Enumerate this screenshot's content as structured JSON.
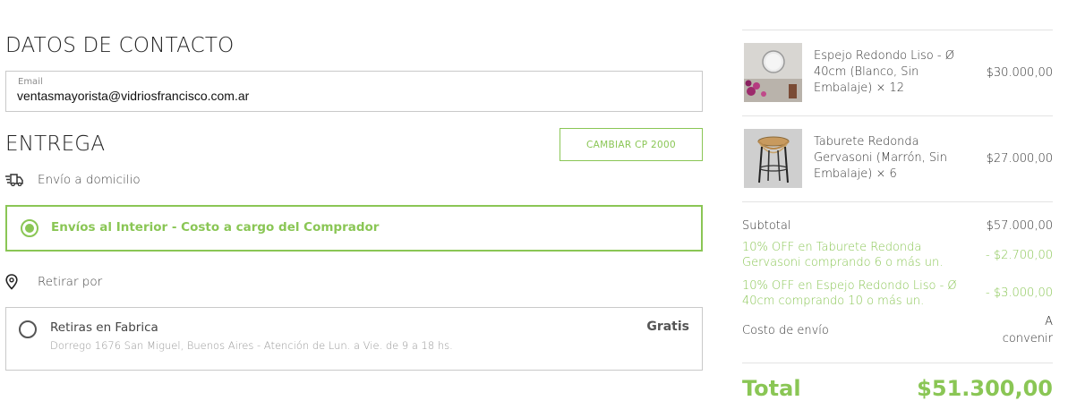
{
  "contact": {
    "title": "DATOS DE CONTACTO",
    "email_label": "Email",
    "email_value": "ventasmayorista@vidriosfrancisco.com.ar"
  },
  "delivery": {
    "title": "ENTREGA",
    "change_cp_label": "CAMBIAR CP 2000",
    "home_delivery_label": "Envío a domicilio",
    "home_options": [
      {
        "label": "Envíos al Interior - Costo a cargo del Comprador",
        "selected": true
      }
    ],
    "pickup_label": "Retirar por",
    "pickup_options": [
      {
        "label": "Retiras en Fabrica",
        "detail": "Dorrego 1676 San Miguel, Buenos Aires - Atención de Lun. a Vie. de 9 a 18 hs.",
        "price": "Gratis",
        "selected": false
      }
    ],
    "accent_color": "#8ac655"
  },
  "cart": {
    "items": [
      {
        "name": "Espejo Redondo Liso - Ø 40cm (Blanco, Sin Embalaje) × 12",
        "price": "$30.000,00",
        "thumb_icon": "mirror-thumbnail"
      },
      {
        "name": "Taburete Redonda Gervasoni (Marrón, Sin Embalaje) × 6",
        "price": "$27.000,00",
        "thumb_icon": "stool-thumbnail"
      }
    ],
    "subtotal_label": "Subtotal",
    "subtotal_value": "$57.000,00",
    "discounts": [
      {
        "label": "10% OFF en Taburete Redonda Gervasoni comprando 6 o más un.",
        "value": "- $2.700,00"
      },
      {
        "label": "10% OFF en Espejo Redondo Liso - Ø 40cm comprando 10 o más un.",
        "value": "- $3.000,00"
      }
    ],
    "shipping_label": "Costo de envío",
    "shipping_value_line1": "A",
    "shipping_value_line2": "convenir",
    "total_label": "Total",
    "total_value": "$51.300,00"
  }
}
